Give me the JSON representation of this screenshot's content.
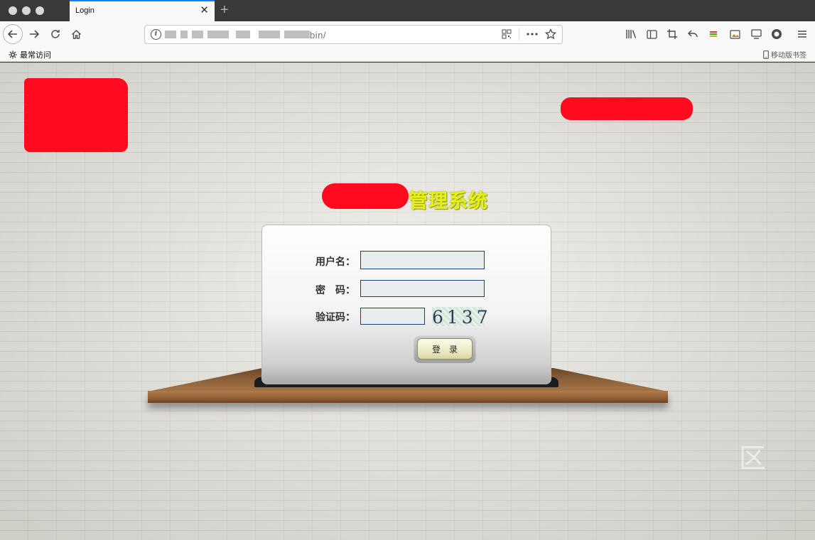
{
  "browser": {
    "tab": {
      "title": "Login",
      "close_glyph": "✕"
    },
    "new_tab_glyph": "+",
    "url_visible_suffix": "bin/",
    "bookmarks": {
      "left_label": "最常访问",
      "right_label": "移动版书签"
    }
  },
  "page": {
    "system_title": "管理系统",
    "form": {
      "username_label": "用户名：",
      "password_label": "密　码：",
      "captcha_label": "验证码：",
      "username_value": "",
      "password_value": "",
      "captcha_value": "",
      "captcha_image_text": "6137",
      "login_button": "登录"
    },
    "watermark": "区"
  },
  "colors": {
    "title_text": "#e6f01b",
    "redaction": "#ff0a1e",
    "field_border": "#1f3f7a",
    "tab_accent": "#0a84ff"
  }
}
